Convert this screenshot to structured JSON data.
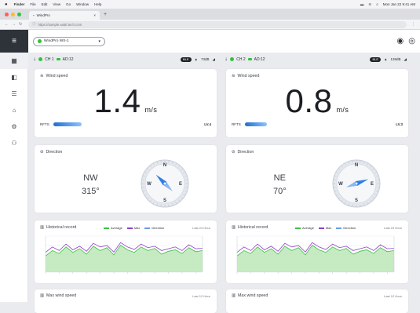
{
  "mac_menu": {
    "apple": "",
    "items": [
      "Finder",
      "File",
      "Edit",
      "View",
      "Go",
      "Window",
      "Help"
    ],
    "clock": "Mon Jan 22  9:41 AM"
  },
  "browser": {
    "tab_title": "WindPro",
    "tab_close": "×",
    "new_tab": "+",
    "url": "https://sample.wattr.tech.com",
    "lights": [
      "#ff5f57",
      "#febc2e",
      "#28c840"
    ]
  },
  "sidebar": {
    "menu_icon": "≡",
    "items": [
      {
        "icon": "dashboard-icon",
        "glyph": "▦",
        "active": true
      },
      {
        "icon": "device-icon",
        "glyph": "◧",
        "active": false
      },
      {
        "icon": "list-icon",
        "glyph": "☰",
        "active": false
      },
      {
        "icon": "monitor-icon",
        "glyph": "⌂",
        "active": false
      },
      {
        "icon": "settings-icon",
        "glyph": "⚙",
        "active": false
      },
      {
        "icon": "users-icon",
        "glyph": "⚇",
        "active": false
      }
    ]
  },
  "topbar": {
    "device": "WindPro WS-1",
    "chevron": "▾"
  },
  "left": {
    "channel": "CH 1",
    "ad": "AD:12",
    "badge": "BLE",
    "rssi": "73dB",
    "speed": {
      "title": "Wind speed",
      "value": "1.4",
      "unit": "m/s",
      "rfts": "RFTS",
      "level": "LV.4",
      "level_fraction": 0.45
    },
    "direction": {
      "title": "Direction",
      "cardinal": "NW",
      "degrees": "315°",
      "angle_deg": 315
    },
    "history": {
      "title": "Historical record",
      "legend": [
        "Average",
        "Max",
        "Direction"
      ],
      "range": "Last 24 Hour"
    },
    "max": {
      "title": "Max wind speed",
      "range": "Last 12 Hour"
    }
  },
  "right": {
    "channel": "CH 2",
    "ad": "AD:12",
    "badge": "BLE",
    "rssi": "138dB",
    "speed": {
      "title": "Wind speed",
      "value": "0.8",
      "unit": "m/s",
      "rfts": "RFTS",
      "level": "LV.3",
      "level_fraction": 0.35
    },
    "direction": {
      "title": "Direction",
      "cardinal": "NE",
      "degrees": "70°",
      "angle_deg": 70
    },
    "history": {
      "title": "Historical record",
      "legend": [
        "Average",
        "Max",
        "Direction"
      ],
      "range": "Last 24 Hour"
    },
    "max": {
      "title": "Max wind speed",
      "range": "Last 12 Hour"
    }
  },
  "compass_labels": {
    "n": "N",
    "e": "E",
    "s": "S",
    "w": "W"
  },
  "colors": {
    "green": "#31c13d",
    "accent": "#2f7ee8",
    "avg": "#3fbf48",
    "max": "#8e3fc4",
    "dir": "#6a9ae8"
  },
  "history_series": {
    "avg": [
      0.45,
      0.6,
      0.52,
      0.7,
      0.55,
      0.65,
      0.5,
      0.72,
      0.6,
      0.68,
      0.48,
      0.75,
      0.62,
      0.55,
      0.7,
      0.6,
      0.66,
      0.5,
      0.58,
      0.62,
      0.52,
      0.68,
      0.57,
      0.6
    ],
    "max": [
      0.55,
      0.7,
      0.6,
      0.78,
      0.62,
      0.72,
      0.58,
      0.8,
      0.7,
      0.74,
      0.56,
      0.82,
      0.7,
      0.63,
      0.78,
      0.68,
      0.72,
      0.6,
      0.65,
      0.7,
      0.6,
      0.76,
      0.65,
      0.66
    ]
  }
}
